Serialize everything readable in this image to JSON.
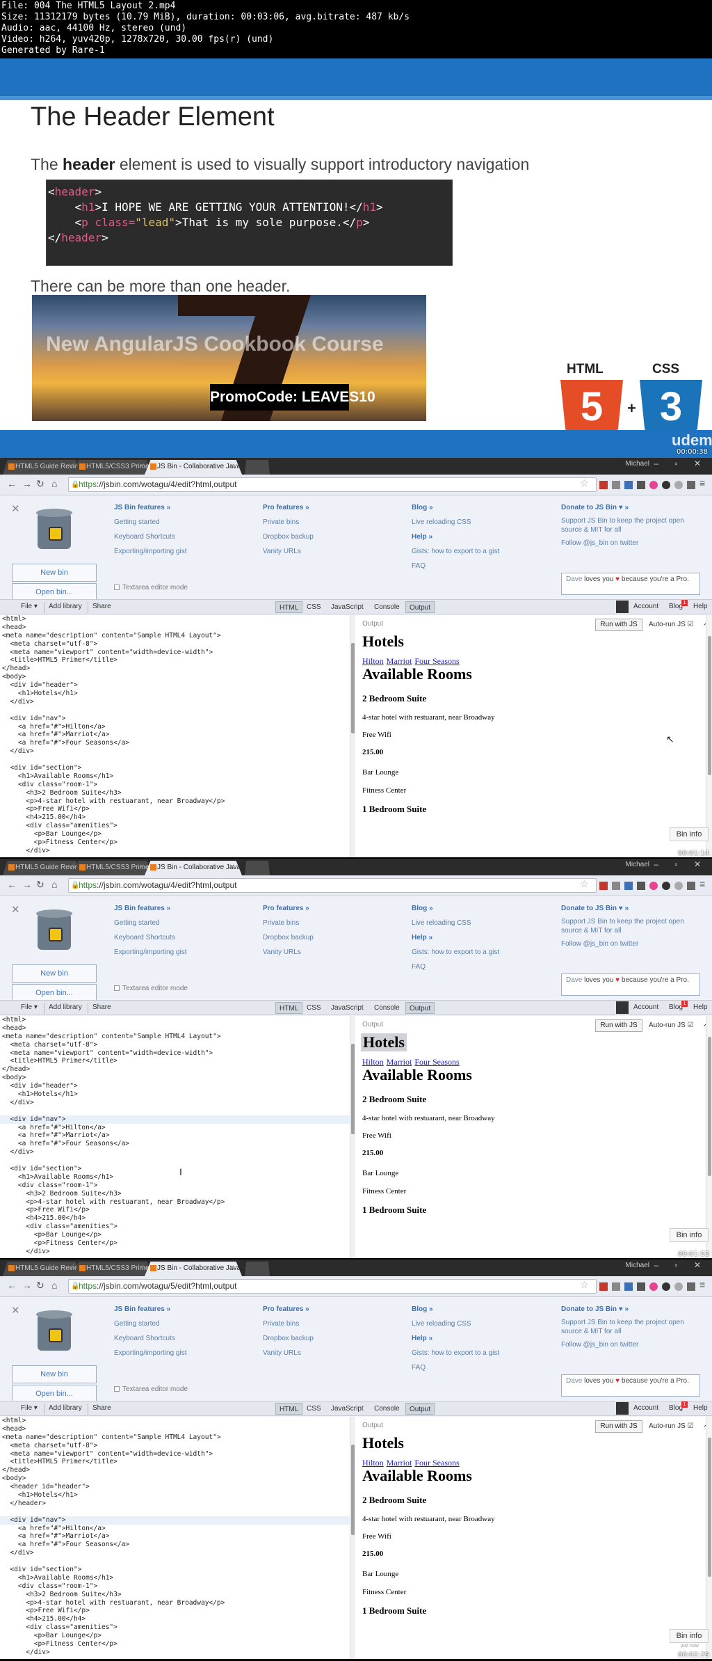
{
  "fileinfo": [
    "File: 004 The HTML5 Layout 2.mp4",
    "Size: 11312179 bytes (10.79 MiB), duration: 00:03:06, avg.bitrate: 487 kb/s",
    "Audio: aac, 44100 Hz, stereo (und)",
    "Video: h264, yuv420p, 1278x720, 30.00 fps(r) (und)",
    "Generated by Rare-1"
  ],
  "slide": {
    "title": "The Header Element",
    "lead_pre": "The ",
    "lead_bold": "header",
    "lead_post": " element is used to visually support introductory navigation",
    "code": {
      "l1_open": "<",
      "l1_tag": "header",
      "l1_close": ">",
      "l2_a": "    <",
      "l2_tag": "h1",
      "l2_b": ">I HOPE WE ARE GETTING YOUR ATTENTION!</",
      "l2_tag2": "h1",
      "l2_c": ">",
      "l3_a": "    <",
      "l3_tag": "p",
      "l3_attr": " class=",
      "l3_str": "\"lead\"",
      "l3_b": ">That is my sole purpose.</",
      "l3_tag2": "p",
      "l3_c": ">",
      "l4_a": "</",
      "l4_tag": "header",
      "l4_c": ">"
    },
    "more": "There can be more than one header.",
    "banner_title": "New AngularJS Cookbook Course",
    "promo": "PromoCode: LEAVES10",
    "html_label": "HTML",
    "css_label": "CSS",
    "html_num": "5",
    "css_num": "3",
    "plus": "+",
    "udemy": "udemy",
    "timestamp": "00:00:38",
    "colors": {
      "blue": "#1f72bf",
      "html5": "#e44d26",
      "css3": "#1b73ba"
    }
  },
  "browser": {
    "tabs": [
      "HTML5 Guide Review | Ud",
      "HTML5/CSS3 Primer - Go",
      "JS Bin - Collaborative Java"
    ],
    "user": "Michael",
    "window_controls": "– ▫ ✕",
    "url_scheme": "https",
    "urls": [
      "://jsbin.com/wotagu/4/edit?html,output",
      "://jsbin.com/wotagu/4/edit?html,output",
      "://jsbin.com/wotagu/5/edit?html,output"
    ],
    "features_title": "JS Bin features »",
    "features": [
      "Getting started",
      "Keyboard Shortcuts",
      "Exporting/importing gist"
    ],
    "pro_title": "Pro features »",
    "pro": [
      "Private bins",
      "Dropbox backup",
      "Vanity URLs"
    ],
    "blog_title": "Blog »",
    "blog": [
      "Live reloading CSS"
    ],
    "help_title": "Help »",
    "help": [
      "Gists: how to export to a gist",
      "FAQ"
    ],
    "donate_title": "Donate to JS Bin ♥ »",
    "donate_text": "Support JS Bin to keep the project open source & MIT for all",
    "follow": "Follow @js_bin on twitter",
    "new_bin": "New bin",
    "open_bin": "Open bin...",
    "textarea_mode": "Textarea editor mode",
    "love_who": "Dave",
    "love_mid": " loves you ",
    "love_heart": "♥",
    "love_end": " because you're a Pro.",
    "toolbar": {
      "file": "File ▾",
      "add_library": "Add library",
      "share": "Share",
      "panels": [
        "HTML",
        "CSS",
        "JavaScript",
        "Console",
        "Output"
      ],
      "account": "Account",
      "blog": "Blog",
      "blog_badge": "1",
      "help": "Help"
    },
    "output_label": "Output",
    "run_js": "Run with JS",
    "autorun": "Auto-run JS ☑",
    "popout": "↗",
    "bin_info": "Bin info",
    "bin_info_sub": "just now",
    "output": {
      "h1": "Hotels",
      "links": [
        "Hilton",
        "Marriot",
        "Four Seasons"
      ],
      "h1b": "Available Rooms",
      "h3": "2 Bedroom Suite",
      "p1": "4-star hotel with restuarant, near Broadway",
      "p2": "Free Wifi",
      "h4": "215.00",
      "p3": "Bar Lounge",
      "p4": "Fitness Center",
      "h3b": "1 Bedroom Suite"
    },
    "code_a": [
      "<html>",
      "<head>",
      "<meta name=\"description\" content=\"Sample HTML4 Layout\">",
      "  <meta charset=\"utf-8\">",
      "  <meta name=\"viewport\" content=\"width=device-width\">",
      "  <title>HTML5 Primer</title>",
      "</head>",
      "<body>",
      "  <div id=\"header\">",
      "    <h1>Hotels</h1>",
      "  </div>",
      "",
      "  <div id=\"nav\">",
      "    <a href=\"#\">Hilton</a>",
      "    <a href=\"#\">Marriot</a>",
      "    <a href=\"#\">Four Seasons</a>",
      "  </div>",
      "",
      "  <div id=\"section\">",
      "    <h1>Available Rooms</h1>",
      "    <div class=\"room-1\">",
      "      <h3>2 Bedroom Suite</h3>",
      "      <p>4-star hotel with restuarant, near Broadway</p>",
      "      <p>Free Wifi</p>",
      "      <h4>215.00</h4>",
      "      <div class=\"amenities\">",
      "        <p>Bar Lounge</p>",
      "        <p>Fitness Center</p>",
      "      </div>"
    ],
    "code_c": [
      "<html>",
      "<head>",
      "<meta name=\"description\" content=\"Sample HTML4 Layout\">",
      "  <meta charset=\"utf-8\">",
      "  <meta name=\"viewport\" content=\"width=device-width\">",
      "  <title>HTML5 Primer</title>",
      "</head>",
      "<body>",
      "  <header id=\"header\">",
      "    <h1>Hotels</h1>",
      "  </header>",
      "",
      "  <div id=\"nav\">",
      "    <a href=\"#\">Hilton</a>",
      "    <a href=\"#\">Marriot</a>",
      "    <a href=\"#\">Four Seasons</a>",
      "  </div>",
      "",
      "  <div id=\"section\">",
      "    <h1>Available Rooms</h1>",
      "    <div class=\"room-1\">",
      "      <h3>2 Bedroom Suite</h3>",
      "      <p>4-star hotel with restuarant, near Broadway</p>",
      "      <p>Free Wifi</p>",
      "      <h4>215.00</h4>",
      "      <div class=\"amenities\">",
      "        <p>Bar Lounge</p>",
      "        <p>Fitness Center</p>",
      "      </div>"
    ],
    "timestamps": [
      "00:01:14",
      "00:01:53",
      "00:02:29"
    ]
  }
}
